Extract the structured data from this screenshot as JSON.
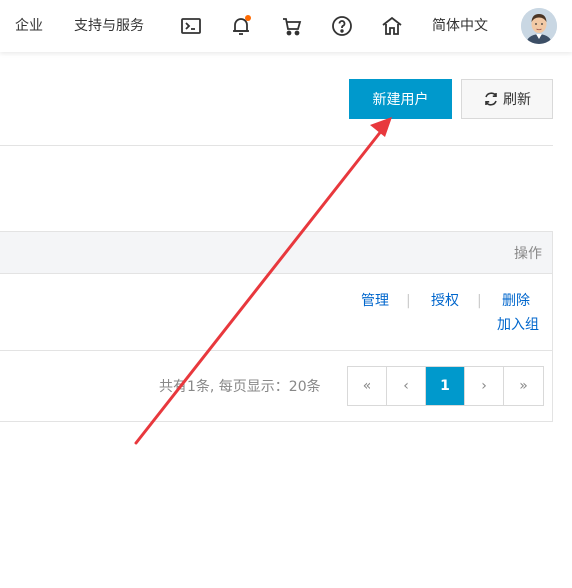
{
  "topbar": {
    "links": [
      {
        "label": "企业"
      },
      {
        "label": "支持与服务"
      }
    ],
    "icons": [
      {
        "name": "terminal-icon"
      },
      {
        "name": "bell-icon"
      },
      {
        "name": "cart-icon"
      },
      {
        "name": "help-icon"
      },
      {
        "name": "home-icon"
      }
    ],
    "language": "简体中文",
    "notification_dot_color": "#ff6a00"
  },
  "toolbar": {
    "new_user_label": "新建用户",
    "refresh_label": "刷新",
    "accent_color": "#0099cc"
  },
  "table": {
    "header_ops_label": "操作",
    "rows": [
      {
        "actions": {
          "manage": "管理",
          "authorize": "授权",
          "delete": "删除",
          "add_to_group": "加入组"
        }
      }
    ]
  },
  "pagination": {
    "summary": "共有1条, 每页显示：20条",
    "first": "«",
    "prev": "‹",
    "current_page": "1",
    "next": "›",
    "last": "»"
  },
  "annotation": {
    "arrow_color": "#e8383d"
  }
}
